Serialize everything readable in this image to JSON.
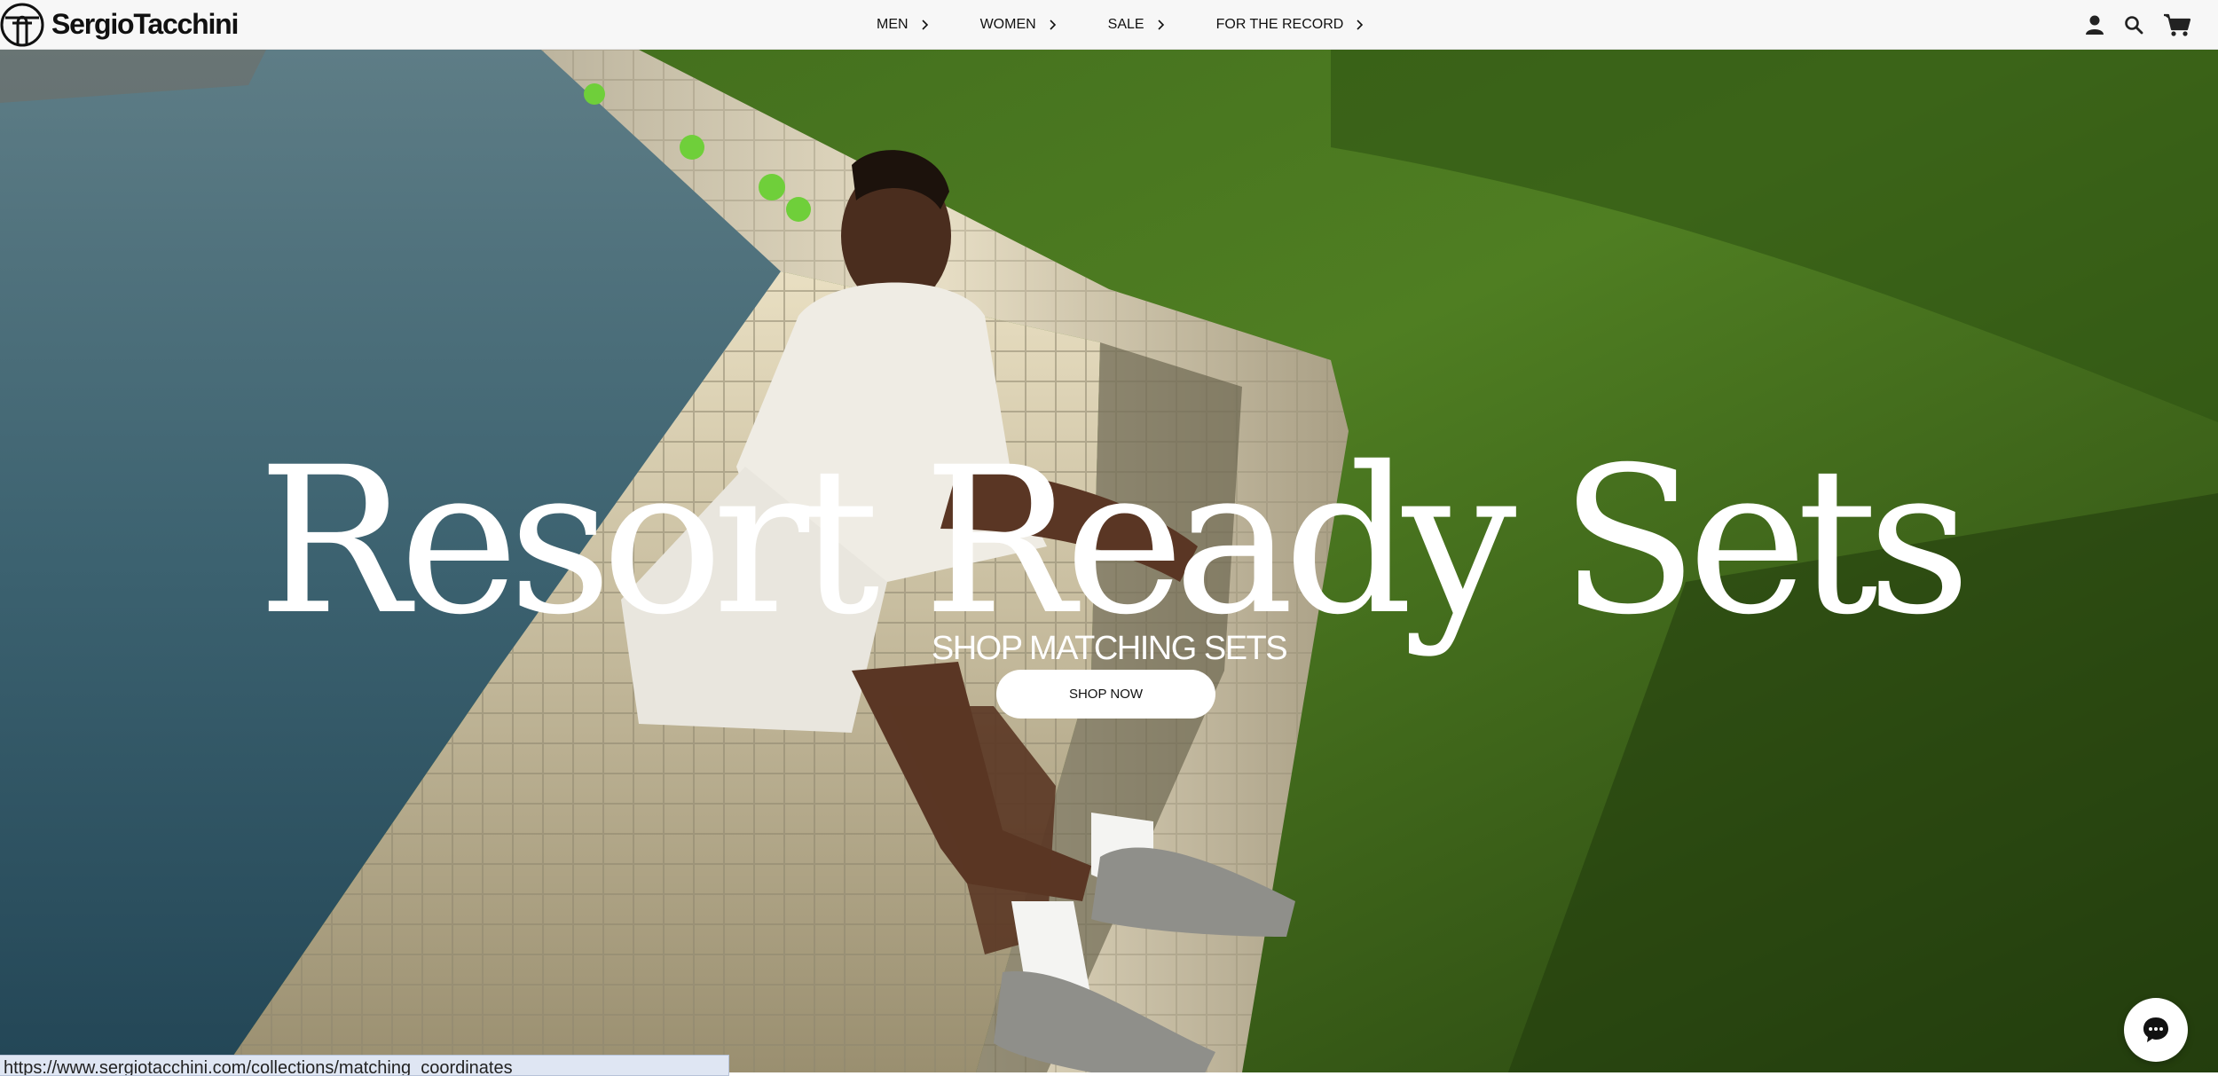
{
  "brand": {
    "name": "SergioTacchini",
    "logo_icon": "sergio-tacchini-st-logo"
  },
  "nav": {
    "items": [
      {
        "label": "MEN"
      },
      {
        "label": "WOMEN"
      },
      {
        "label": "SALE"
      },
      {
        "label": "FOR THE RECORD"
      }
    ]
  },
  "header_icons": [
    "account-icon",
    "search-icon",
    "cart-icon"
  ],
  "hero": {
    "title": "Resort Ready Sets",
    "subtitle": "SHOP MATCHING SETS",
    "button_label": "SHOP NOW",
    "image_description_icon": "hero-image"
  },
  "status_bar": {
    "url": "https://www.sergiotacchini.com/collections/matching_coordinates"
  },
  "chat": {
    "icon": "chat-bubble-icon"
  },
  "colors": {
    "header_bg": "#f7f7f7",
    "text": "#111111",
    "hero_text": "#ffffff",
    "button_bg": "#ffffff"
  }
}
